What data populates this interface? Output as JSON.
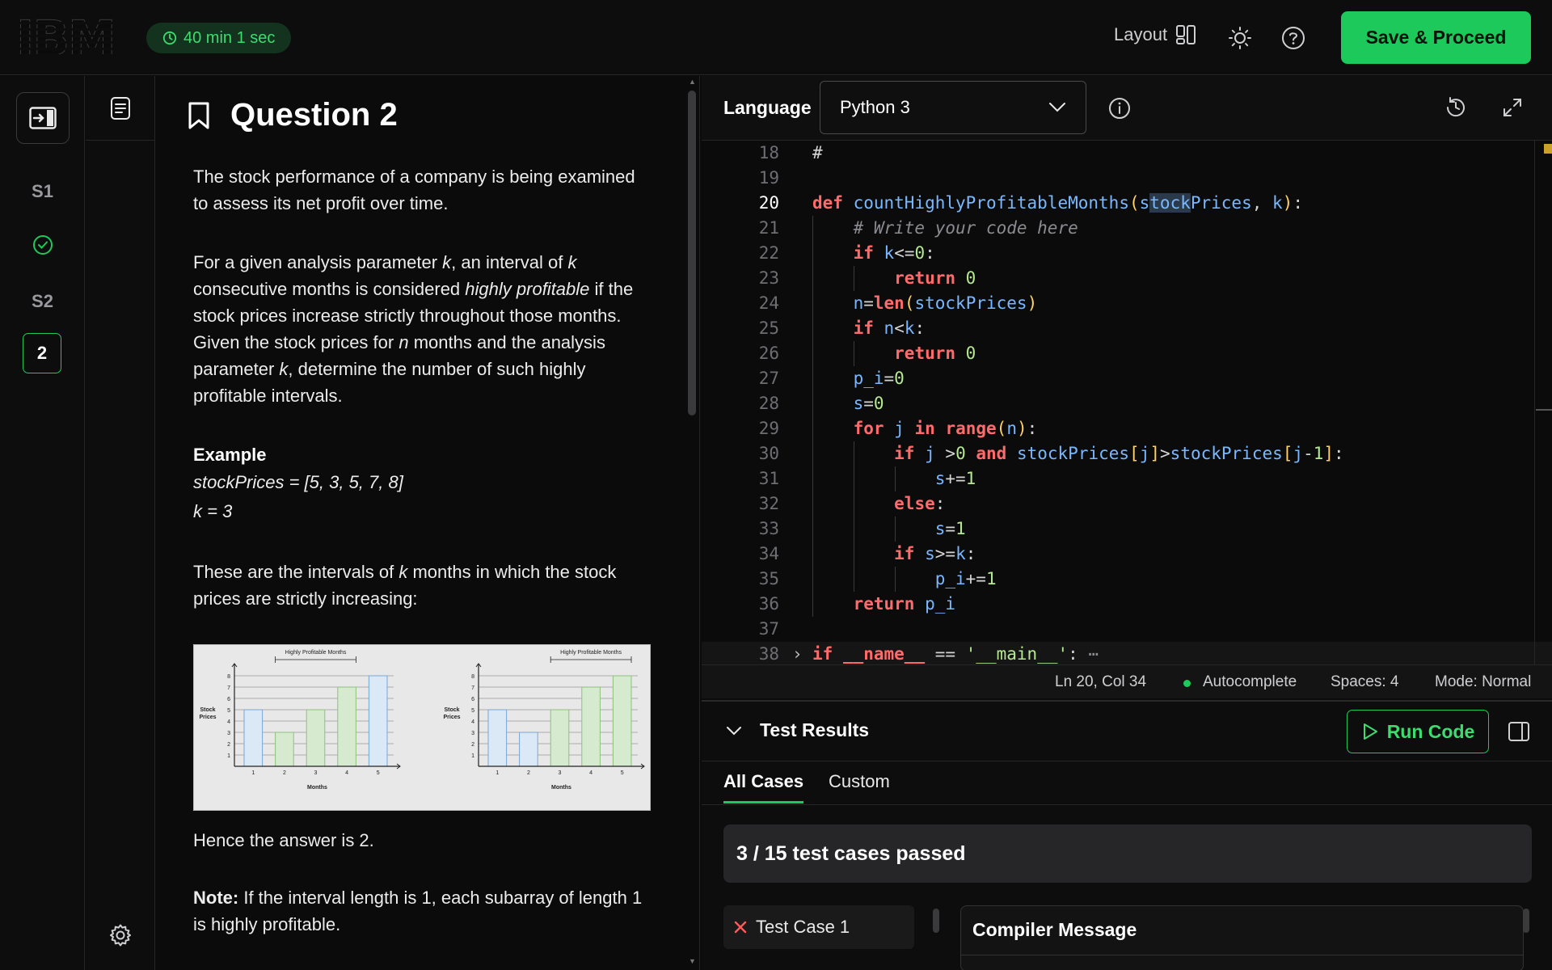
{
  "header": {
    "logo": "IBM",
    "timer": "40 min 1 sec",
    "layout_label": "Layout",
    "save_label": "Save & Proceed"
  },
  "rail": {
    "items": [
      "S1",
      "S2",
      "2"
    ]
  },
  "question": {
    "title": "Question 2",
    "p1": "The stock performance of a company is being examined to assess its net profit over time.",
    "p2_a": "For a given analysis parameter ",
    "p2_k1": "k",
    "p2_b": ", an interval of ",
    "p2_k2": "k",
    "p2_c": " consecutive months is considered ",
    "p2_hp": "highly profitable",
    "p2_d": " if the stock prices increase strictly throughout those months. Given the stock prices for ",
    "p2_n": "n",
    "p2_e": " months and the analysis parameter ",
    "p2_k3": "k",
    "p2_f": ", determine the number of such highly profitable intervals.",
    "example_head": "Example",
    "example_line1": "stockPrices = [5, 3, 5, 7, 8]",
    "example_line2": "k = 3",
    "p3_a": "These are the intervals of ",
    "p3_k": "k",
    "p3_b": " months in which the stock prices are strictly increasing:",
    "answer": "Hence the answer is 2.",
    "note_label": "Note:",
    "note_text": " If the interval length is 1, each subarray of length 1 is highly profitable."
  },
  "figure": {
    "panel_title": "Highly Profitable Months",
    "ylabel_1": "Stock",
    "ylabel_2": "Prices",
    "xlabel": "Months",
    "yticks": [
      "1",
      "2",
      "3",
      "4",
      "5",
      "6",
      "7",
      "8"
    ],
    "xticks": [
      "1",
      "2",
      "3",
      "4",
      "5"
    ],
    "values": [
      5,
      3,
      5,
      7,
      8
    ]
  },
  "editor": {
    "language_label": "Language",
    "language_value": "Python 3",
    "status_pos": "Ln 20, Col 34",
    "status_autocomplete": "Autocomplete",
    "status_spaces": "Spaces: 4",
    "status_mode": "Mode: Normal",
    "line_numbers": [
      "18",
      "19",
      "20",
      "21",
      "22",
      "23",
      "24",
      "25",
      "26",
      "27",
      "28",
      "29",
      "30",
      "31",
      "32",
      "33",
      "34",
      "35",
      "36",
      "37",
      "38"
    ]
  },
  "tests": {
    "title": "Test Results",
    "run_label": "Run Code",
    "tab_all": "All Cases",
    "tab_custom": "Custom",
    "passed": "3 / 15 test cases passed",
    "case1": "Test Case 1",
    "compiler_title": "Compiler Message"
  },
  "colors": {
    "accent": "#1dc95a",
    "background": "#0b0b0c"
  }
}
